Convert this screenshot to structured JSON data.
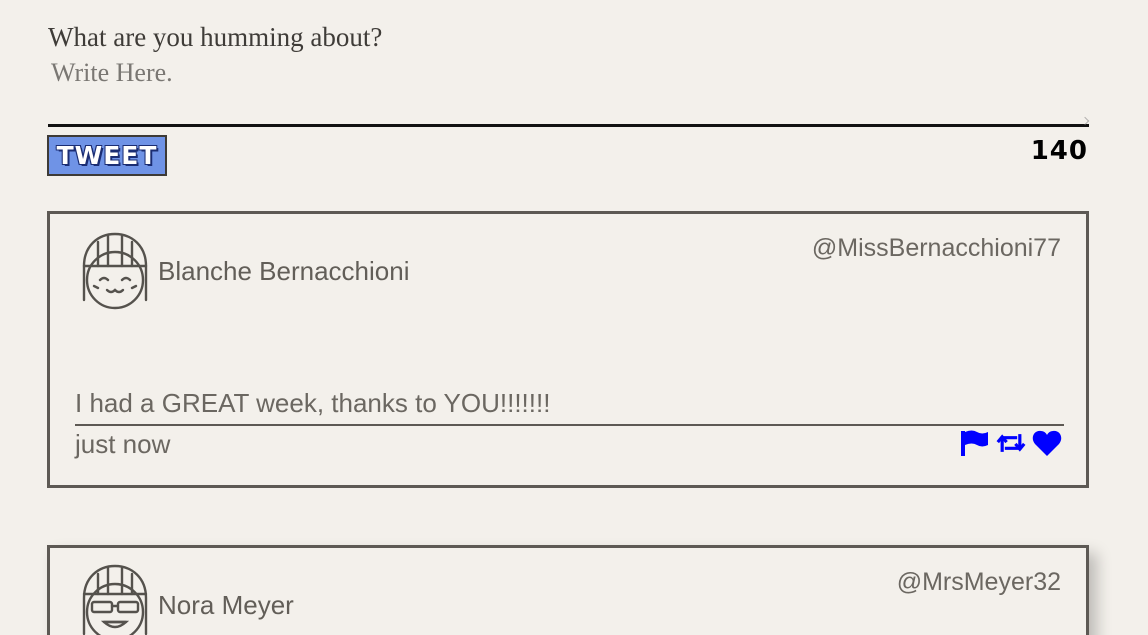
{
  "compose": {
    "prompt": "What are you humming about?",
    "placeholder": "Write Here.",
    "button_label": "TWEET",
    "char_count": "140"
  },
  "tweets": [
    {
      "name": "Blanche Bernacchioni",
      "handle": "@MissBernacchioni77",
      "text": "I had a GREAT week, thanks to YOU!!!!!!!",
      "time": "just now",
      "avatar_icon": "girl-avatar-icon"
    },
    {
      "name": "Nora Meyer",
      "handle": "@MrsMeyer32",
      "avatar_icon": "girl-with-sunglasses-avatar-icon"
    }
  ],
  "colors": {
    "background": "#f3f0eb",
    "button": "#6f93e6",
    "action_icons": "#0000ff",
    "border": "#5d5954"
  }
}
